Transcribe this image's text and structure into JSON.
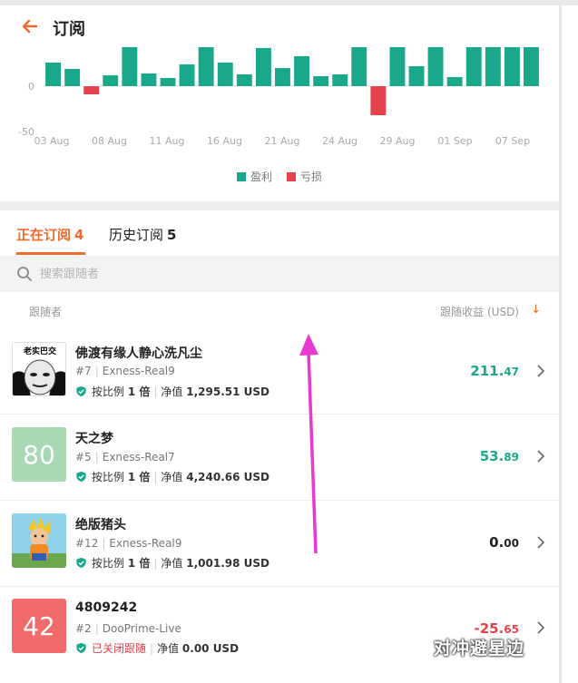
{
  "header": {
    "title": "订阅"
  },
  "colors": {
    "accent": "#f06a2b",
    "profit": "#1aa88a",
    "loss": "#e5424d",
    "arrow": "#e83ad0"
  },
  "chart_data": {
    "type": "bar",
    "ytick_labels": [
      "0",
      "-50"
    ],
    "x_labels": [
      "03 Aug",
      "08 Aug",
      "11 Aug",
      "16 Aug",
      "21 Aug",
      "24 Aug",
      "29 Aug",
      "01 Sep",
      "07 Sep"
    ],
    "values": [
      26,
      19,
      -9,
      12,
      43,
      14,
      9,
      24,
      43,
      26,
      13,
      42,
      20,
      33,
      11,
      13,
      43,
      -32,
      43,
      22,
      43,
      10,
      43,
      43,
      43,
      43
    ],
    "legend": [
      {
        "name": "盈利",
        "color": "#1aa88a"
      },
      {
        "name": "亏损",
        "color": "#e5424d"
      }
    ],
    "ylim": [
      -50,
      45
    ]
  },
  "tabs": {
    "active": {
      "label": "正在订阅",
      "count": "4"
    },
    "history": {
      "label": "历史订阅",
      "count": "5"
    }
  },
  "search": {
    "placeholder": "搜索跟随者",
    "value": ""
  },
  "columns": {
    "follower": "跟随者",
    "profit": "跟随收益 (USD)"
  },
  "followers": [
    {
      "name": "佛渡有缘人静心洗凡尘",
      "rank": "#7",
      "account": "Exness-Real9",
      "ratio_label": "按比例",
      "ratio": "1 倍",
      "equity_label": "净值",
      "equity": "1,295.51 USD",
      "profit_int": "211.",
      "profit_dec": "47",
      "profit_color": "#1aa88a",
      "avatar_text": "老实巴交",
      "avatar_type": "meme",
      "status": ""
    },
    {
      "name": "天之梦",
      "rank": "#5",
      "account": "Exness-Real7",
      "ratio_label": "按比例",
      "ratio": "1 倍",
      "equity_label": "净值",
      "equity": "4,240.66 USD",
      "profit_int": "53.",
      "profit_dec": "89",
      "profit_color": "#1aa88a",
      "avatar_text": "80",
      "avatar_color": "#a8d8b4",
      "avatar_type": "number",
      "status": ""
    },
    {
      "name": "绝版猪头",
      "rank": "#12",
      "account": "Exness-Real9",
      "ratio_label": "按比例",
      "ratio": "1 倍",
      "equity_label": "净值",
      "equity": "1,001.98 USD",
      "profit_int": "0.",
      "profit_dec": "00",
      "profit_color": "#222222",
      "avatar_type": "photo",
      "status": ""
    },
    {
      "name": "4809242",
      "rank": "#2",
      "account": "DooPrime-Live",
      "ratio_label": "",
      "ratio": "",
      "equity_label": "净值",
      "equity": "0.00 USD",
      "profit_int": "-25.",
      "profit_dec": "65",
      "profit_color": "#e5424d",
      "avatar_text": "42",
      "avatar_color": "#f26b6b",
      "avatar_type": "number",
      "status": "已关闭跟随"
    }
  ],
  "watermark": "对冲避星边"
}
